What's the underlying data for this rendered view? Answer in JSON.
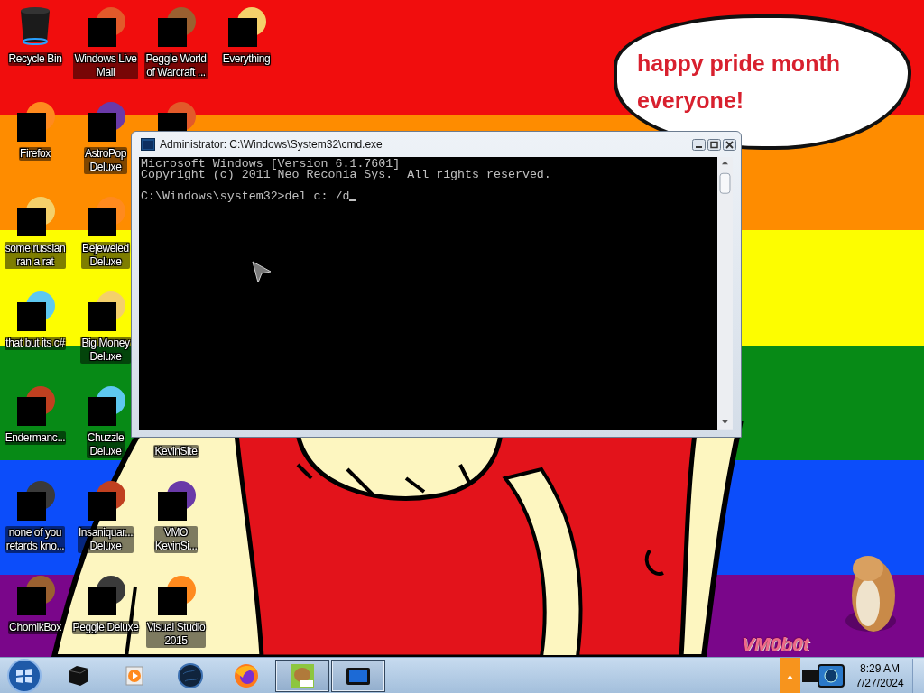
{
  "desktop": {
    "columns": [
      {
        "icons": [
          {
            "kind": "bin",
            "redacted": false,
            "label_lines": [
              "Recycle Bin"
            ]
          },
          {
            "kind": "app",
            "redacted": true,
            "label_lines": [
              "Firefox"
            ]
          },
          {
            "kind": "app",
            "redacted": true,
            "label_lines": [
              "some russian",
              "ran a rat"
            ]
          },
          {
            "kind": "app",
            "redacted": true,
            "label_lines": [
              "that but its c#"
            ]
          },
          {
            "kind": "app",
            "redacted": true,
            "label_lines": [
              "Endermanc..."
            ]
          },
          {
            "kind": "app",
            "redacted": true,
            "label_lines": [
              "none of you",
              "retards kno..."
            ]
          },
          {
            "kind": "app",
            "redacted": true,
            "label_lines": [
              "ChomikBox"
            ]
          }
        ]
      },
      {
        "icons": [
          {
            "kind": "app",
            "redacted": true,
            "label_lines": [
              "Windows Live",
              "Mail"
            ]
          },
          {
            "kind": "app",
            "redacted": true,
            "label_lines": [
              "AstroPop",
              "Deluxe"
            ]
          },
          {
            "kind": "app",
            "redacted": true,
            "label_lines": [
              "Bejeweled",
              "Deluxe"
            ]
          },
          {
            "kind": "app",
            "redacted": true,
            "label_lines": [
              "Big Money",
              "Deluxe"
            ]
          },
          {
            "kind": "app",
            "redacted": true,
            "label_lines": [
              "Chuzzle",
              "Deluxe"
            ]
          },
          {
            "kind": "app",
            "redacted": true,
            "label_lines": [
              "Insaniquar...",
              "Deluxe"
            ]
          },
          {
            "kind": "app",
            "redacted": true,
            "label_lines": [
              "Peggle Deluxe"
            ]
          }
        ]
      },
      {
        "icons": [
          {
            "kind": "app",
            "redacted": true,
            "label_lines": [
              "Peggle World",
              "of Warcraft ..."
            ]
          },
          {
            "kind": "covered",
            "redacted": true
          },
          {
            "kind": "gap"
          },
          {
            "kind": "gap"
          },
          {
            "kind": "label-under",
            "label_lines": [
              "KevinSite"
            ]
          },
          {
            "kind": "app",
            "redacted": true,
            "label_lines": [
              "VMO",
              "KevinSi..."
            ]
          },
          {
            "kind": "app",
            "redacted": true,
            "label_lines": [
              "Visual Studio",
              "2015"
            ]
          }
        ]
      },
      {
        "icons": [
          {
            "kind": "app",
            "redacted": true,
            "label_lines": [
              "Everything"
            ]
          }
        ]
      }
    ]
  },
  "speech_bubble": {
    "lines": [
      "happy pride month",
      "everyone!"
    ]
  },
  "wallpaper_caption": "VM0b0t",
  "console_window": {
    "title": "Administrator: C:\\Windows\\System32\\cmd.exe",
    "output": [
      "Microsoft Windows [Version 6.1.7601]",
      "Copyright (c) 2011 Neo Reconia Sys.  All rights reserved."
    ],
    "prompt": "C:\\Windows\\system32>del c: /d"
  },
  "taskbar": {
    "pinned": [
      {
        "kind": "cube",
        "running": false
      },
      {
        "kind": "media",
        "running": false
      },
      {
        "kind": "globe",
        "running": false
      },
      {
        "kind": "browser",
        "running": false
      },
      {
        "kind": "hamster",
        "running": true
      },
      {
        "kind": "terminal",
        "running": true
      }
    ],
    "clock": {
      "time": "8:29 AM",
      "date": "7/27/2024"
    }
  }
}
